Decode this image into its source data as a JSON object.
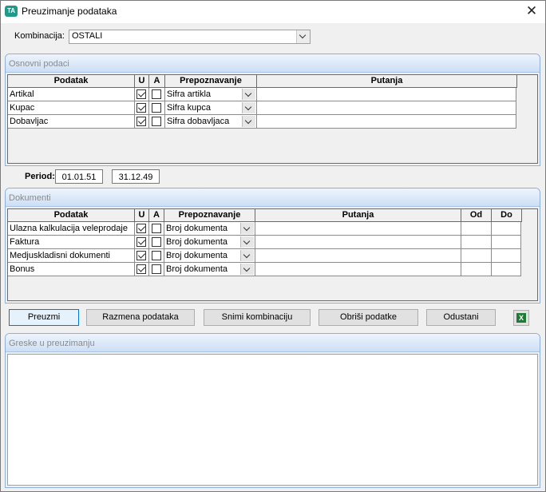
{
  "window": {
    "title": "Preuzimanje podataka",
    "icon": "app-logo-icon"
  },
  "kombinacija": {
    "label": "Kombinacija:",
    "value": "OSTALI"
  },
  "osnovni": {
    "title": "Osnovni podaci",
    "headers": [
      "Podatak",
      "U",
      "A",
      "Prepoznavanje",
      "Putanja"
    ],
    "rows": [
      {
        "podatak": "Artikal",
        "u": true,
        "a": false,
        "prepoznavanje": "Sifra artikla",
        "putanja": ""
      },
      {
        "podatak": "Kupac",
        "u": true,
        "a": false,
        "prepoznavanje": "Sifra kupca",
        "putanja": ""
      },
      {
        "podatak": "Dobavljac",
        "u": true,
        "a": false,
        "prepoznavanje": "Sifra dobavljaca",
        "putanja": ""
      }
    ]
  },
  "period": {
    "label": "Period:",
    "from": "01.01.51",
    "to": "31.12.49"
  },
  "dokumenti": {
    "title": "Dokumenti",
    "headers": [
      "Podatak",
      "U",
      "A",
      "Prepoznavanje",
      "Putanja",
      "Od",
      "Do"
    ],
    "rows": [
      {
        "podatak": "Ulazna kalkulacija veleprodaje",
        "u": true,
        "a": false,
        "prepoznavanje": "Broj dokumenta",
        "putanja": "",
        "od": "",
        "do": ""
      },
      {
        "podatak": "Faktura",
        "u": true,
        "a": false,
        "prepoznavanje": "Broj dokumenta",
        "putanja": "",
        "od": "",
        "do": ""
      },
      {
        "podatak": "Medjuskladisni dokumenti",
        "u": true,
        "a": false,
        "prepoznavanje": "Broj dokumenta",
        "putanja": "",
        "od": "",
        "do": ""
      },
      {
        "podatak": "Bonus",
        "u": true,
        "a": false,
        "prepoznavanje": "Broj dokumenta",
        "putanja": "",
        "od": "",
        "do": ""
      }
    ]
  },
  "buttons": {
    "preuzmi": "Preuzmi",
    "razmena": "Razmena podataka",
    "snimi": "Snimi kombinaciju",
    "obrisi": "Obriši podatke",
    "odustani": "Odustani",
    "excel_icon": "excel-icon"
  },
  "greske": {
    "title": "Greske u preuzimanju",
    "content": ""
  }
}
